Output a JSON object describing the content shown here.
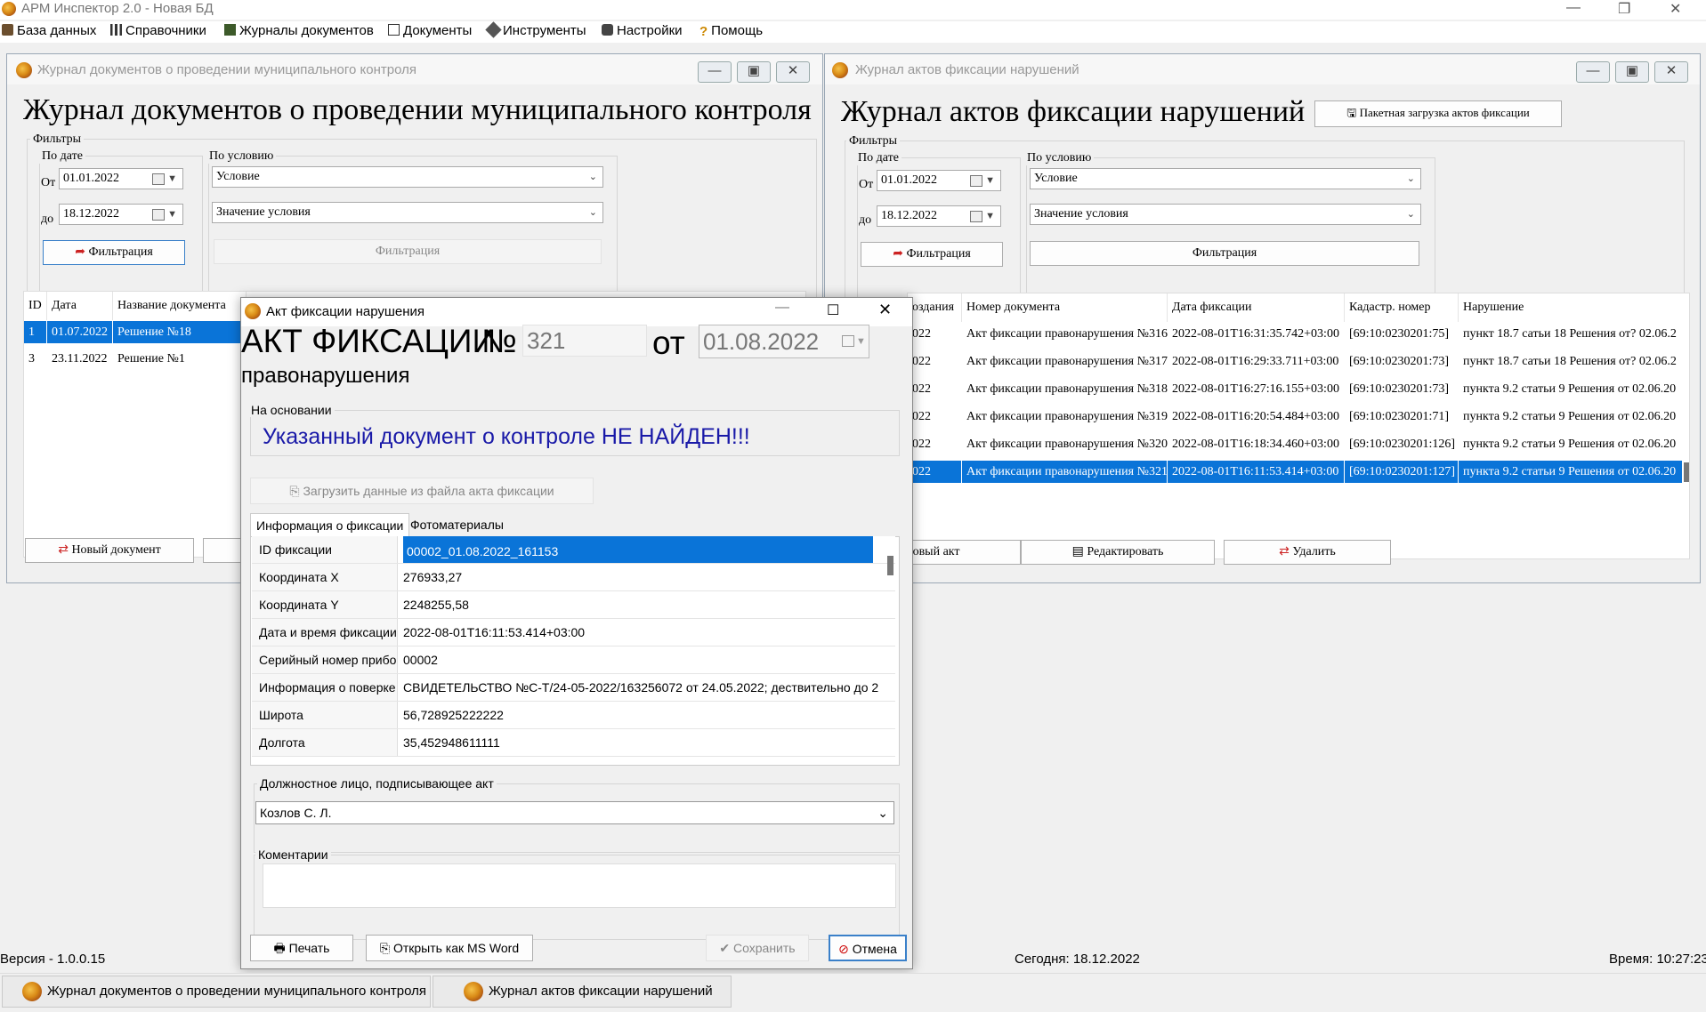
{
  "app": {
    "title": "АРМ Инспектор 2.0 - Новая БД",
    "win_min": "—",
    "win_max": "❐",
    "win_close": "✕"
  },
  "menu": [
    {
      "label": "База данных",
      "icon": "database-icon"
    },
    {
      "label": "Справочники",
      "icon": "chart-icon"
    },
    {
      "label": "Журналы документов",
      "icon": "journal-icon"
    },
    {
      "label": "Документы",
      "icon": "documents-icon"
    },
    {
      "label": "Инструменты",
      "icon": "tools-icon"
    },
    {
      "label": "Настройки",
      "icon": "settings-icon"
    },
    {
      "label": "Помощь",
      "icon": "help-icon"
    }
  ],
  "left_window": {
    "caption": "Журнал документов о проведении муниципального контроля",
    "title": "Журнал документов о проведении муниципального контроля",
    "filters_label": "Фильтры",
    "by_date_label": "По дате",
    "from_label": "От",
    "from_value": "01.01.2022",
    "to_label": "до",
    "to_value": "18.12.2022",
    "filter_button": "Фильтрация",
    "by_condition_label": "По условию",
    "condition_value": "Условие",
    "condition_value_value": "Значение условия",
    "filter_condition_button": "Фильтрация",
    "columns": [
      "ID",
      "Дата",
      "Название документа"
    ],
    "rows": [
      {
        "id": "1",
        "date": "01.07.2022",
        "name": "Решение №18",
        "selected": true
      },
      {
        "id": "3",
        "date": "23.11.2022",
        "name": "Решение №1",
        "selected": false
      }
    ],
    "new_doc_button": "Новый документ"
  },
  "right_window": {
    "caption": "Журнал актов фиксации нарушений",
    "title": "Журнал актов фиксации нарушений",
    "batch_button": "Пакетная загрузка актов фиксации",
    "filters_label": "Фильтры",
    "by_date_label": "По дате",
    "from_label": "От",
    "from_value": "01.01.2022",
    "to_label": "до",
    "to_value": "18.12.2022",
    "filter_button": "Фильтрация",
    "by_condition_label": "По условию",
    "condition_value": "Условие",
    "condition_value_value": "Значение условия",
    "filter_condition_button": "Фильтрация",
    "columns": [
      "оздания",
      "Номер документа",
      "Дата фиксации",
      "Кадастр. номер",
      "Нарушение"
    ],
    "rows": [
      {
        "created": "022",
        "number": "Акт фиксации правонарушения №316",
        "date": "2022-08-01T16:31:35.742+03:00",
        "cad": "[69:10:0230201:75]",
        "violation": "пункт 18.7 сатьи 18 Решения от? 02.06.2"
      },
      {
        "created": "022",
        "number": "Акт фиксации правонарушения №317",
        "date": "2022-08-01T16:29:33.711+03:00",
        "cad": "[69:10:0230201:73]",
        "violation": "пункт 18.7 сатьи 18 Решения от? 02.06.2"
      },
      {
        "created": "022",
        "number": "Акт фиксации правонарушения №318",
        "date": "2022-08-01T16:27:16.155+03:00",
        "cad": "[69:10:0230201:73]",
        "violation": "пункта 9.2 статьи 9 Решения от 02.06.20"
      },
      {
        "created": "022",
        "number": "Акт фиксации правонарушения №319",
        "date": "2022-08-01T16:20:54.484+03:00",
        "cad": "[69:10:0230201:71]",
        "violation": "пункта 9.2 статьи 9 Решения от 02.06.20"
      },
      {
        "created": "022",
        "number": "Акт фиксации правонарушения №320",
        "date": "2022-08-01T16:18:34.460+03:00",
        "cad": "[69:10:0230201:126]",
        "violation": "пункта 9.2 статьи 9 Решения от 02.06.20"
      },
      {
        "created": "022",
        "number": "Акт фиксации правонарушения №321",
        "date": "2022-08-01T16:11:53.414+03:00",
        "cad": "[69:10:0230201:127]",
        "violation": "пункта 9.2 статьи 9 Решения от 02.06.20"
      }
    ],
    "new_act_button": "Новый акт",
    "edit_button": "Редактировать",
    "delete_button": "Удалить"
  },
  "dialog": {
    "caption": "Акт фиксации нарушения",
    "heading1": "АКТ ФИКСАЦИИ",
    "num_sign": "№",
    "number_value": "321",
    "from_word": "от",
    "date_value": "01.08.2022",
    "heading2": "правонарушения",
    "basis_label": "На основании",
    "not_found_message": "Указанный документ о контроле НЕ НАЙДЕН!!!",
    "load_button": "Загрузить данные из файла акта фиксации",
    "tabs": [
      "Информация о фиксации",
      "Фотоматериалы"
    ],
    "properties": [
      {
        "key": "ID фиксации",
        "value": "00002_01.08.2022_161153",
        "selected": true
      },
      {
        "key": "Координата X",
        "value": "276933,27",
        "selected": false
      },
      {
        "key": "Координата Y",
        "value": "2248255,58",
        "selected": false
      },
      {
        "key": "Дата и время фиксации",
        "value": "2022-08-01T16:11:53.414+03:00",
        "selected": false
      },
      {
        "key": "Серийный номер прибо",
        "value": "00002",
        "selected": false
      },
      {
        "key": "Информация о поверке",
        "value": "СВИДЕТЕЛЬСТВО №С-Т/24-05-2022/163256072 от 24.05.2022; дествительно до 2",
        "selected": false
      },
      {
        "key": "Широта",
        "value": "56,728925222222",
        "selected": false
      },
      {
        "key": "Долгота",
        "value": "35,452948611111",
        "selected": false
      }
    ],
    "official_label": "Должностное лицо, подписывающее акт",
    "official_value": "Козлов С. Л.",
    "comments_label": "Коментарии",
    "comments_value": "",
    "print_button": "Печать",
    "word_button": "Открыть как MS Word",
    "save_button": "Сохранить",
    "cancel_button": "Отмена"
  },
  "statusbar": {
    "version": "Версия - 1.0.0.15",
    "today": "Сегодня: 18.12.2022",
    "time": "Время: 10:27:23"
  },
  "taskbar": [
    "Журнал документов о проведении муниципального контроля",
    "Журнал актов фиксации нарушений"
  ],
  "colors": {
    "selection": "#0a74d8",
    "message": "#1a1aa8"
  }
}
